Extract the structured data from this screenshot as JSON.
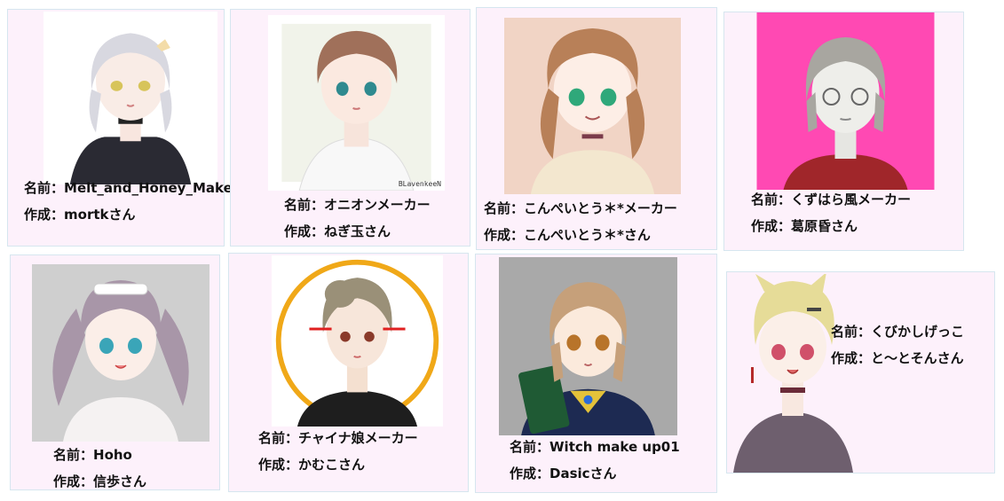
{
  "labels": {
    "name_prefix": "名前：",
    "author_prefix": "作成："
  },
  "cards": [
    {
      "name": "Melt_and_Honey_Maker",
      "author": "mortkさん",
      "hair": "#d8d8e0",
      "bg": "#ffffff"
    },
    {
      "name": "オニオンメーカー",
      "author": "ねぎ玉さん",
      "hair": "#a0705a",
      "bg": "#f1f3ea",
      "signature": "BLavenkeeN"
    },
    {
      "name": "こんぺいとう＊*メーカー",
      "author": "こんぺいとう＊*さん",
      "hair": "#b88058",
      "bg": "#f1d4c5"
    },
    {
      "name": "くずはら風メーカー",
      "author": "葛原昏さん",
      "hair": "#a8a6a0",
      "bg": "#ff49b3"
    },
    {
      "name": "Hoho",
      "author": "信歩さん",
      "hair": "#a896a8",
      "bg": "#cfcfcf"
    },
    {
      "name": "チャイナ娘メーカー",
      "author": "かむこさん",
      "hair": "#9a9078",
      "bg": "#ffffff",
      "accent": "#f0a818"
    },
    {
      "name": "Witch make up01",
      "author": "Dasicさん",
      "hair": "#c6a07a",
      "bg": "#a9a9a9"
    },
    {
      "name": "くびかしげっこ",
      "author": "と～とそんさん",
      "hair": "#e6dc98",
      "bg": "#fdf1fb"
    }
  ]
}
